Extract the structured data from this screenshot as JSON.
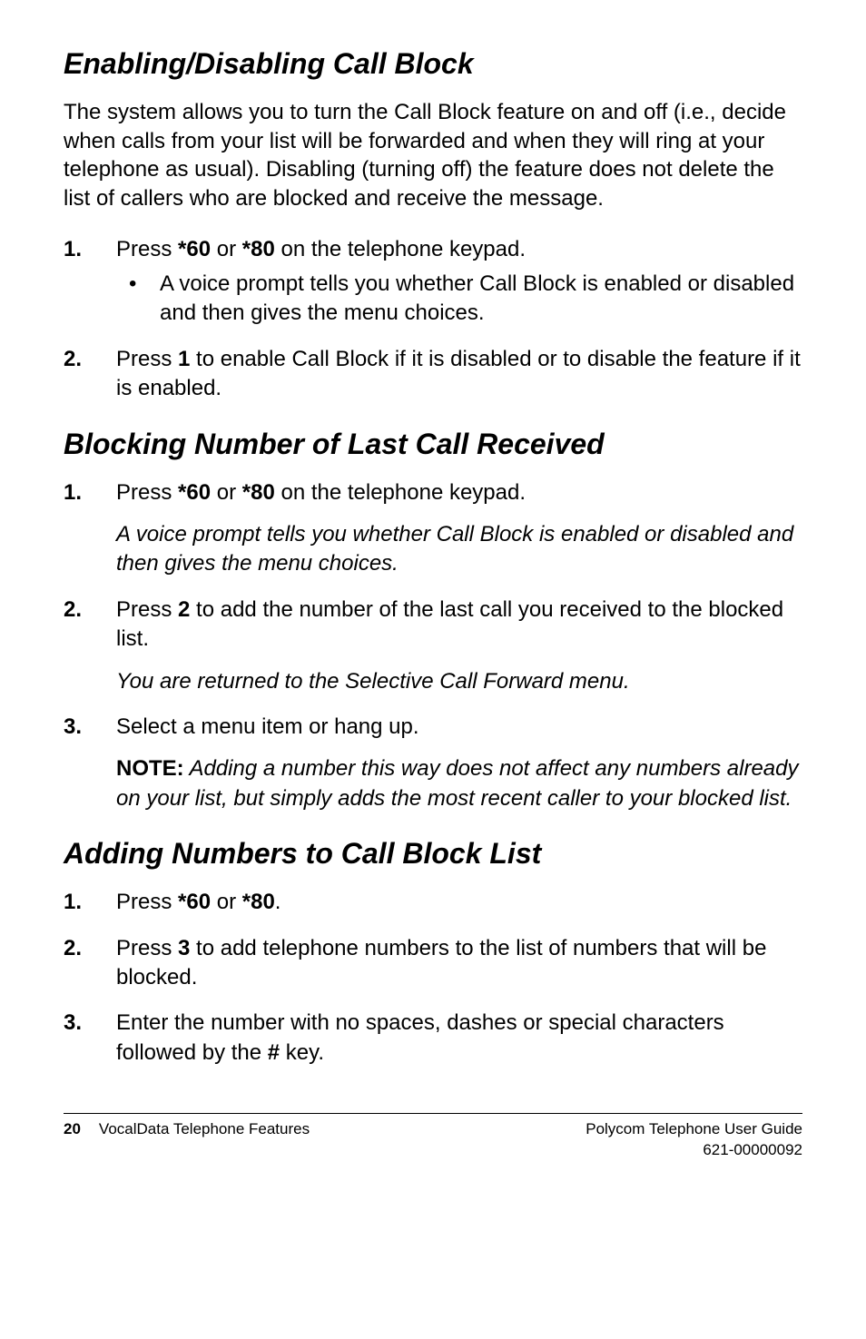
{
  "sections": {
    "s1": {
      "title": "Enabling/Disabling Call Block",
      "intro_pre": "The ",
      "intro_post": " system allows you to turn the Call Block feature on and off (i.e., decide when calls from your list will be forwarded and when they will ring at your telephone as usual). Disabling (turning off) the feature does not delete the list of callers who are blocked and receive the message.",
      "step1_marker": "1.",
      "step1_pre": "Press ",
      "step1_b1": "*60",
      "step1_mid": " or ",
      "step1_b2": "*80",
      "step1_post": " on the telephone keypad.",
      "step1_bullet": "A voice prompt tells you whether Call Block is enabled or disabled and then gives the menu choices.",
      "step2_marker": "2.",
      "step2_pre": "Press ",
      "step2_b": "1",
      "step2_post": " to enable Call Block if it is disabled or to disable the feature if it is enabled."
    },
    "s2": {
      "title": "Blocking Number of Last Call Received",
      "step1_marker": "1.",
      "step1_pre": "Press ",
      "step1_b1": "*60",
      "step1_mid": " or ",
      "step1_b2": "*80",
      "step1_post": " on the telephone keypad.",
      "step1_italic": "A voice prompt tells you whether Call Block is enabled or disabled and then gives the menu choices.",
      "step2_marker": "2.",
      "step2_pre": "Press ",
      "step2_b": "2",
      "step2_post": " to add the number of the last call you received to the blocked list.",
      "step2_italic": "You are returned to the Selective Call Forward menu.",
      "step3_marker": "3.",
      "step3_text": "Select a menu item or hang up.",
      "step3_note_label": "NOTE:",
      "step3_note_body": " Adding a number this way does not affect any numbers already on your list, but simply adds the most recent caller to your blocked list."
    },
    "s3": {
      "title": "Adding Numbers to Call Block List",
      "step1_marker": "1.",
      "step1_pre": "Press ",
      "step1_b1": "*60",
      "step1_mid": " or ",
      "step1_b2": "*80",
      "step1_post": ".",
      "step2_marker": "2.",
      "step2_pre": "Press ",
      "step2_b": "3",
      "step2_post": " to add telephone numbers to the list of numbers that will be blocked.",
      "step3_marker": "3.",
      "step3_pre": "Enter the number with no spaces, dashes or special characters followed by the ",
      "step3_b": "#",
      "step3_post": " key."
    }
  },
  "footer": {
    "page_number": "20",
    "left_text": "VocalData Telephone Features",
    "right_line1": "Polycom Telephone User Guide",
    "right_line2": "621-00000092"
  }
}
